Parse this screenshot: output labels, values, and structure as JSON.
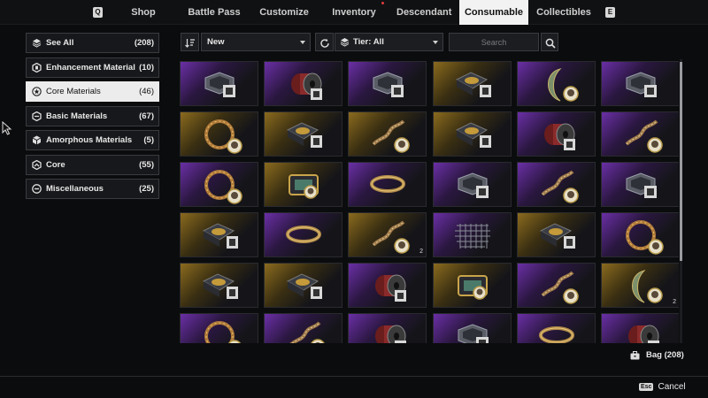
{
  "nav": {
    "left_key": "Q",
    "right_key": "E",
    "tabs": [
      "Shop",
      "Battle Pass",
      "Customize",
      "Inventory",
      "Descendant",
      "Consumable",
      "Collectibles"
    ],
    "active_tab": "Consumable"
  },
  "categories": [
    {
      "label": "See All",
      "count": "(208)",
      "icon": "layers-icon"
    },
    {
      "label": "Enhancement Material",
      "count": "(10)",
      "icon": "hexagon-icon"
    },
    {
      "label": "Core Materials",
      "count": "(46)",
      "icon": "star-circle-icon",
      "active": true
    },
    {
      "label": "Basic Materials",
      "count": "(67)",
      "icon": "stack-icon"
    },
    {
      "label": "Amorphous Materials",
      "count": "(5)",
      "icon": "polyhedron-icon"
    },
    {
      "label": "Core",
      "count": "(55)",
      "icon": "chevron-up-icon"
    },
    {
      "label": "Miscellaneous",
      "count": "(25)",
      "icon": "minus-circle-icon"
    }
  ],
  "toolbar": {
    "sort_value": "New",
    "tier_value": "Tier: All",
    "search_placeholder": "Search"
  },
  "grid": {
    "rows": [
      [
        {
          "tier": "purple",
          "item": "pouch"
        },
        {
          "tier": "purple",
          "item": "spool"
        },
        {
          "tier": "purple",
          "item": "pouch"
        },
        {
          "tier": "gold",
          "item": "box"
        },
        {
          "tier": "purple",
          "item": "crescent"
        },
        {
          "tier": "purple",
          "item": "pouch"
        }
      ],
      [
        {
          "tier": "gold",
          "item": "ring"
        },
        {
          "tier": "gold",
          "item": "box"
        },
        {
          "tier": "gold",
          "item": "helix"
        },
        {
          "tier": "gold",
          "item": "box"
        },
        {
          "tier": "purple",
          "item": "spool"
        },
        {
          "tier": "purple",
          "item": "helix"
        }
      ],
      [
        {
          "tier": "purple",
          "item": "ring"
        },
        {
          "tier": "gold",
          "item": "chip"
        },
        {
          "tier": "purple",
          "item": "band"
        },
        {
          "tier": "purple",
          "item": "pouch"
        },
        {
          "tier": "purple",
          "item": "helix"
        },
        {
          "tier": "purple",
          "item": "pouch"
        }
      ],
      [
        {
          "tier": "gold",
          "item": "box"
        },
        {
          "tier": "purple",
          "item": "band"
        },
        {
          "tier": "gold",
          "item": "helix",
          "qty": "2"
        },
        {
          "tier": "purple",
          "item": "mesh"
        },
        {
          "tier": "gold",
          "item": "box"
        },
        {
          "tier": "purple",
          "item": "ring"
        }
      ],
      [
        {
          "tier": "gold",
          "item": "box"
        },
        {
          "tier": "gold",
          "item": "box"
        },
        {
          "tier": "purple",
          "item": "spool"
        },
        {
          "tier": "gold",
          "item": "chip"
        },
        {
          "tier": "purple",
          "item": "helix"
        },
        {
          "tier": "gold",
          "item": "crescent",
          "qty": "2"
        }
      ],
      [
        {
          "tier": "purple",
          "item": "ring"
        },
        {
          "tier": "purple",
          "item": "helix"
        },
        {
          "tier": "purple",
          "item": "spool"
        },
        {
          "tier": "purple",
          "item": "pouch"
        },
        {
          "tier": "purple",
          "item": "band"
        },
        {
          "tier": "purple",
          "item": "spool"
        }
      ]
    ]
  },
  "bag": {
    "label": "Bag (208)"
  },
  "footer": {
    "esc_key": "Esc",
    "cancel_label": "Cancel"
  }
}
